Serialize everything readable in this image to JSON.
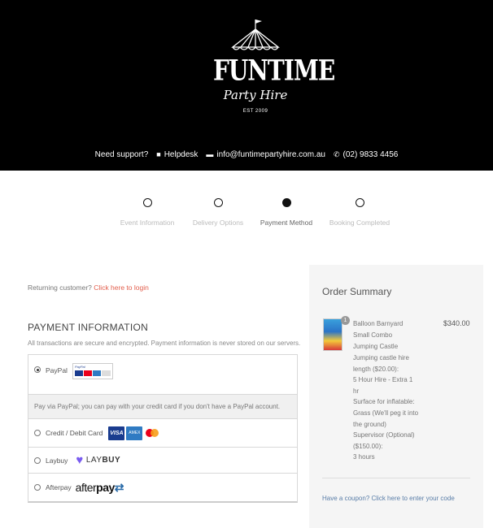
{
  "header": {
    "logo": {
      "title": "FUNTIME",
      "subtitle": "Party Hire",
      "est": "EST 2009"
    },
    "support": {
      "prompt": "Need support?",
      "helpdesk": "Helpdesk",
      "email": "info@funtimepartyhire.com.au",
      "phone": "(02) 9833 4456"
    }
  },
  "steps": [
    {
      "label": "Event Information",
      "active": false
    },
    {
      "label": "Delivery Options",
      "active": false
    },
    {
      "label": "Payment Method",
      "active": true
    },
    {
      "label": "Booking Completed",
      "active": false
    }
  ],
  "login": {
    "prompt": "Returning customer?",
    "link": "Click here to login"
  },
  "payment": {
    "title": "PAYMENT INFORMATION",
    "description": "All transactions are secure and encrypted. Payment information is never stored on our servers.",
    "methods": {
      "paypal": {
        "label": "PayPal",
        "description": "Pay via PayPal; you can pay with your credit card if you don't have a PayPal account.",
        "selected": true
      },
      "card": {
        "label": "Credit / Debit Card",
        "selected": false
      },
      "laybuy": {
        "label": "Laybuy",
        "logo_prefix": "LAY",
        "logo_suffix": "BUY",
        "selected": false
      },
      "afterpay": {
        "label": "Afterpay",
        "logo_prefix": "after",
        "logo_suffix": "pay",
        "selected": false
      }
    },
    "card_logos": {
      "visa": "VISA",
      "amex": "AMEX"
    }
  },
  "summary": {
    "title": "Order Summary",
    "item": {
      "name": "Balloon Barnyard Small Combo Jumping Castle",
      "qty": "1",
      "price": "$340.00",
      "options": [
        "Jumping castle hire length ($20.00):",
        "5 Hour Hire - Extra 1 hr",
        "Surface for inflatable: Grass (We'll peg it into the ground)",
        "Supervisor (Optional) ($150.00):",
        "3 hours"
      ]
    },
    "coupon": "Have a coupon? Click here to enter your code"
  },
  "colors": {
    "header_bg": "#000000",
    "link": "#e25d4b",
    "coupon_link": "#5a7ea8",
    "summary_bg": "#f5f5f5"
  }
}
